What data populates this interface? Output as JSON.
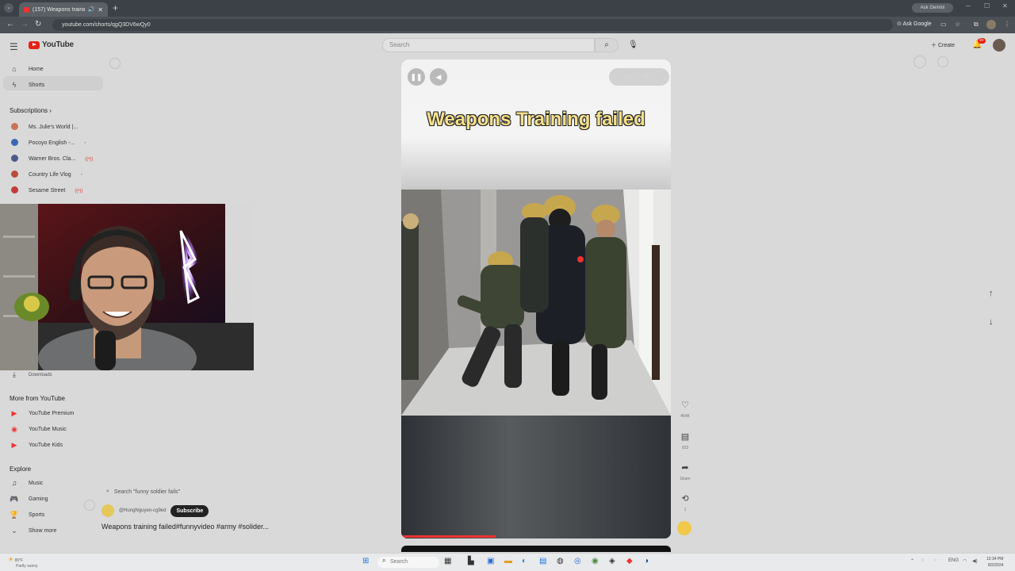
{
  "browser": {
    "tab_title": "(157) Weapons training fail",
    "url": "youtube.com/shorts/qgQ3DV6wQy0",
    "ask_gemini": "Ask Gemini",
    "ask_google": "Ask Google"
  },
  "header": {
    "logo": "YouTube",
    "search_placeholder": "Search",
    "create_label": "Create",
    "notification_count": "9+"
  },
  "sidebar": {
    "home": "Home",
    "shorts": "Shorts",
    "subscriptions_title": "Subscriptions",
    "subscriptions": [
      {
        "name": "Ms. Julie's World |...",
        "color": "#c9715a"
      },
      {
        "name": "Pocoyo English -...",
        "color": "#3a66b8"
      },
      {
        "name": "Warner Bros. Cla...",
        "color": "#4a5a8a"
      },
      {
        "name": "Country Life Vlog",
        "color": "#b84b3a"
      },
      {
        "name": "Sesame Street",
        "color": "#c43a3a"
      }
    ],
    "downloads": "Downloads",
    "more_title": "More from YouTube",
    "more": [
      "YouTube Premium",
      "YouTube Music",
      "YouTube Kids"
    ],
    "explore_title": "Explore",
    "explore": [
      "Music",
      "Gaming",
      "Sports"
    ],
    "show_more": "Show more"
  },
  "short": {
    "overlay_title": "Weapons Training failed",
    "progress_fraction": 0.35,
    "search_suggestion": "Search \"funny soldier fails\"",
    "channel_handle": "@HungNguyen-cg9ed",
    "subscribe_label": "Subscribe",
    "caption": "Weapons training failed#funnyvideo #army #solider...",
    "likes": "464K",
    "comments": "923",
    "share": "Share",
    "remix": "1"
  },
  "taskbar": {
    "search_placeholder": "Search",
    "weather_temp": "80°F",
    "weather_desc": "Partly sunny",
    "time": "12:34 PM",
    "date": "8/2/2024",
    "lang": "ENG"
  }
}
